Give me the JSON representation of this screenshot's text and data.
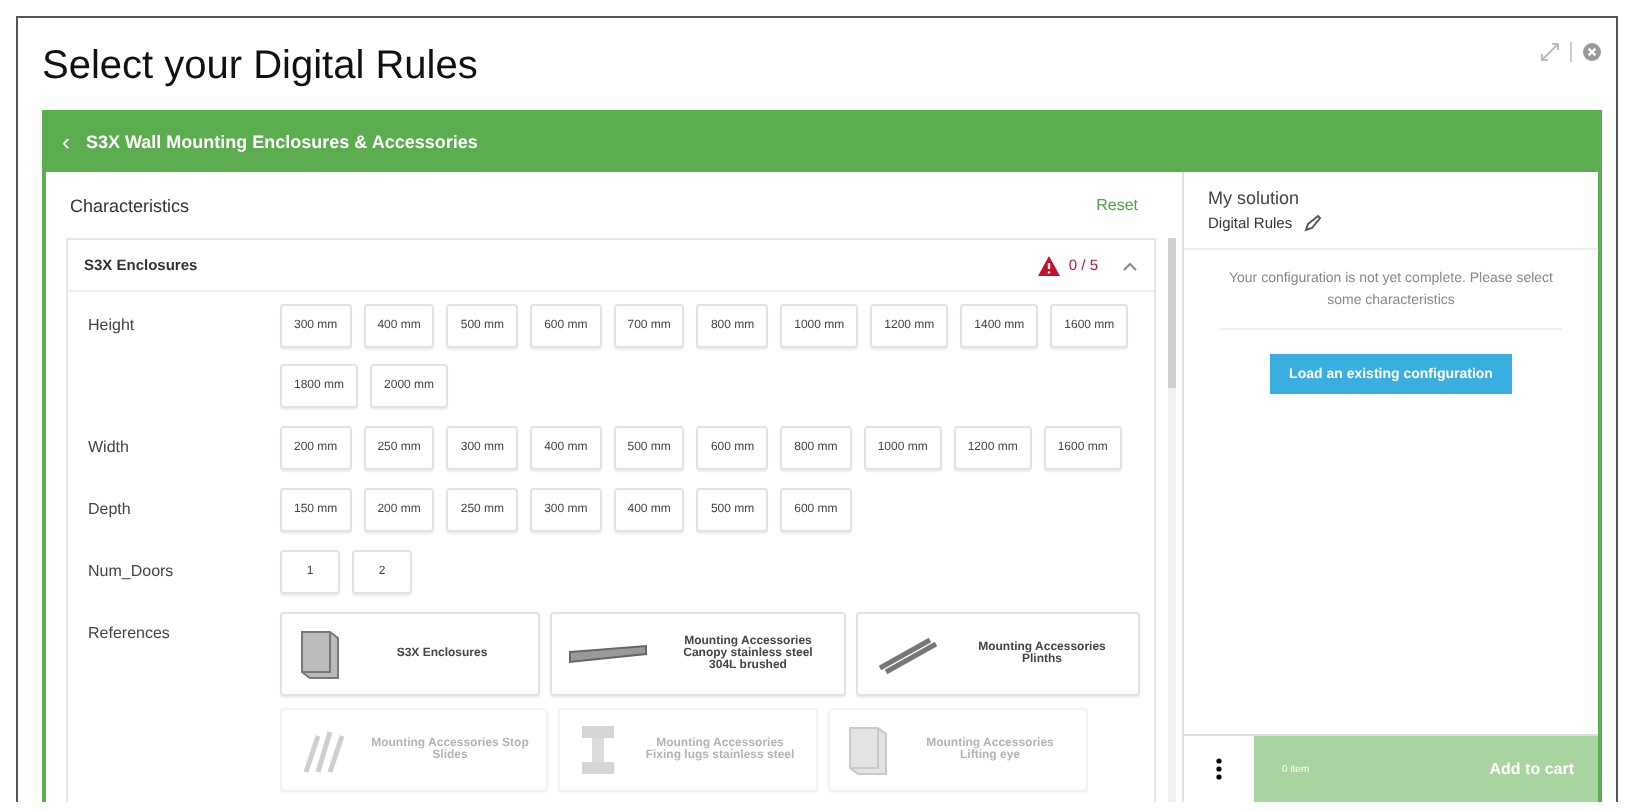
{
  "title": "Select your Digital Rules",
  "breadcrumb": {
    "back": "‹",
    "label": "S3X Wall Mounting Enclosures & Accessories"
  },
  "characteristics": {
    "heading": "Characteristics",
    "reset": "Reset",
    "section": {
      "name": "S3X Enclosures",
      "count": "0 / 5",
      "expanded": true,
      "groups": [
        {
          "label": "Height",
          "kind": "options",
          "options": [
            "300 mm",
            "400 mm",
            "500 mm",
            "600 mm",
            "700 mm",
            "800 mm",
            "1000 mm",
            "1200 mm",
            "1400 mm",
            "1600 mm",
            "1800 mm",
            "2000 mm"
          ]
        },
        {
          "label": "Width",
          "kind": "options",
          "options": [
            "200 mm",
            "250 mm",
            "300 mm",
            "400 mm",
            "500 mm",
            "600 mm",
            "800 mm",
            "1000 mm",
            "1200 mm",
            "1600 mm"
          ]
        },
        {
          "label": "Depth",
          "kind": "options",
          "options": [
            "150 mm",
            "200 mm",
            "250 mm",
            "300 mm",
            "400 mm",
            "500 mm",
            "600 mm"
          ]
        },
        {
          "label": "Num_Doors",
          "kind": "options",
          "options": [
            "1",
            "2"
          ]
        },
        {
          "label": "References",
          "kind": "references",
          "references": [
            {
              "text": "S3X Enclosures",
              "kind": "cabinet",
              "disabled": false
            },
            {
              "text": "Mounting Accessories Canopy stainless steel 304L brushed",
              "kind": "canopy",
              "disabled": false
            },
            {
              "text": "Mounting Accessories Plinths",
              "kind": "rails",
              "disabled": false
            },
            {
              "text": "Mounting Accessories Stop Slides",
              "kind": "bolts",
              "disabled": true
            },
            {
              "text": "Mounting Accessories Fixing lugs stainless steel",
              "kind": "lugs",
              "disabled": true
            },
            {
              "text": "Mounting Accessories Lifting eye",
              "kind": "cabinet",
              "disabled": true
            }
          ]
        }
      ]
    }
  },
  "solution": {
    "heading": "My solution",
    "name": "Digital Rules",
    "message": "Your configuration is not yet complete. Please select some characteristics",
    "load_button": "Load an existing configuration",
    "items": "0 item",
    "add_to_cart": "Add to cart",
    "add_to_cart_disabled": true
  }
}
